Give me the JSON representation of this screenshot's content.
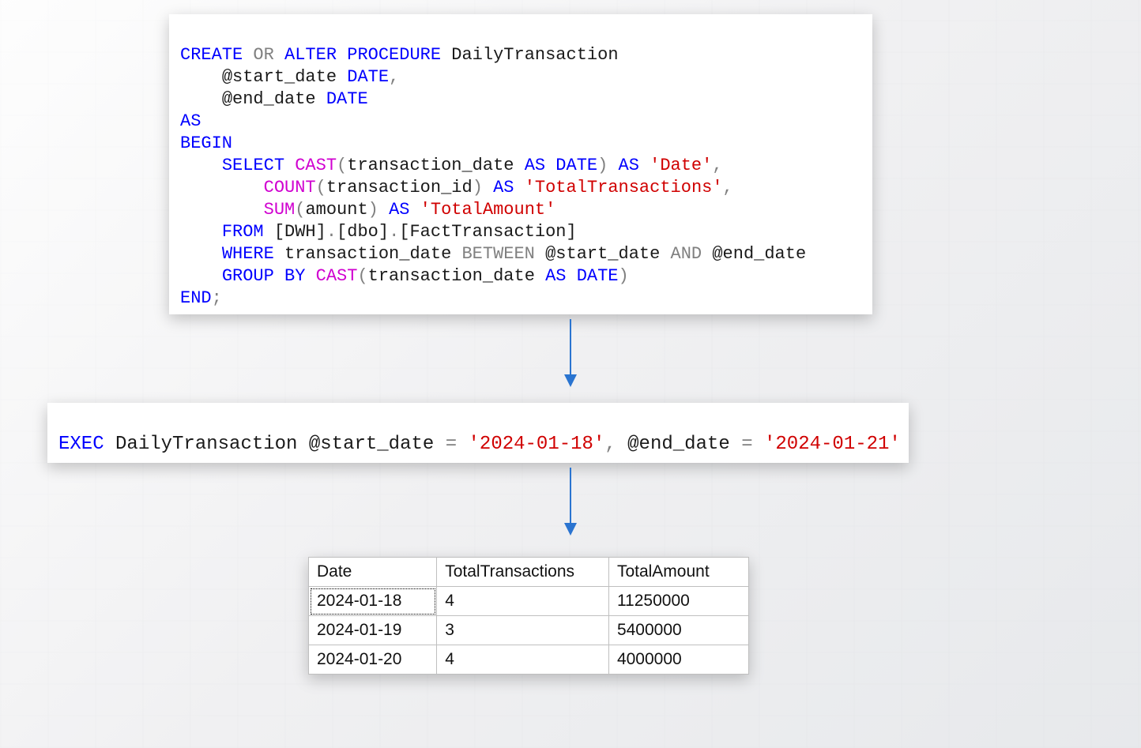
{
  "code1": {
    "l1": {
      "t1": "CREATE",
      "t2": "OR",
      "t3": "ALTER",
      "t4": "PROCEDURE",
      "t5": "DailyTransaction"
    },
    "l2": {
      "t1": "@start_date",
      "t2": "DATE",
      "comma": ","
    },
    "l3": {
      "t1": "@end_date",
      "t2": "DATE"
    },
    "l4": {
      "t1": "AS"
    },
    "l5": {
      "t1": "BEGIN"
    },
    "l6": {
      "t1": "SELECT",
      "t2": "CAST",
      "lp": "(",
      "t3": "transaction_date",
      "t4": "AS",
      "t5": "DATE",
      "rp": ")",
      "t6": "AS",
      "t7": "'Date'",
      "comma": ","
    },
    "l7": {
      "t1": "COUNT",
      "lp": "(",
      "t2": "transaction_id",
      "rp": ")",
      "t3": "AS",
      "t4": "'TotalTransactions'",
      "comma": ","
    },
    "l8": {
      "t1": "SUM",
      "lp": "(",
      "t2": "amount",
      "rp": ")",
      "t3": "AS",
      "t4": "'TotalAmount'"
    },
    "l9": {
      "t1": "FROM",
      "t2": "[DWH]",
      "dot1": ".",
      "t3": "[dbo]",
      "dot2": ".",
      "t4": "[FactTransaction]"
    },
    "l10": {
      "t1": "WHERE",
      "t2": "transaction_date",
      "t3": "BETWEEN",
      "t4": "@start_date",
      "t5": "AND",
      "t6": "@end_date"
    },
    "l11": {
      "t1": "GROUP",
      "t2": "BY",
      "t3": "CAST",
      "lp": "(",
      "t4": "transaction_date",
      "t5": "AS",
      "t6": "DATE",
      "rp": ")"
    },
    "l12": {
      "t1": "END",
      "semi": ";"
    }
  },
  "code2": {
    "t1": "EXEC",
    "t2": "DailyTransaction",
    "t3": "@start_date",
    "eq1": "=",
    "t4": "'2024-01-18'",
    "comma": ",",
    "t5": "@end_date",
    "eq2": "=",
    "t6": "'2024-01-21'"
  },
  "result": {
    "headers": {
      "c1": "Date",
      "c2": "TotalTransactions",
      "c3": "TotalAmount"
    },
    "rows": [
      {
        "c1": "2024-01-18",
        "c2": "4",
        "c3": "11250000"
      },
      {
        "c1": "2024-01-19",
        "c2": "3",
        "c3": "5400000"
      },
      {
        "c1": "2024-01-20",
        "c2": "4",
        "c3": "4000000"
      }
    ]
  }
}
